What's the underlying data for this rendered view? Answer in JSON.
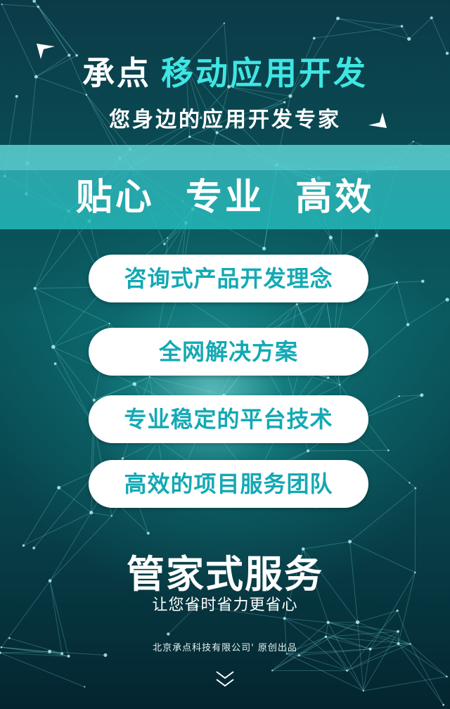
{
  "header": {
    "title_part1": "承点",
    "title_part2": "移动应用开发",
    "subtitle": "您身边的应用开发专家"
  },
  "banner": {
    "text": "贴心  专业  高效"
  },
  "features": [
    "咨询式产品开发理念",
    "全网解决方案",
    "专业稳定的平台技术",
    "高效的项目服务团队"
  ],
  "service": {
    "title": "管家式服务",
    "subtitle": "让您省时省力更省心"
  },
  "footer": {
    "credit": "北京承点科技有限公司' 原创出品"
  },
  "colors": {
    "accent": "#3fe6e2",
    "pill_text": "#13a9b4",
    "background_dark": "#0a4d55"
  },
  "icons": {
    "top_left": "arrow-corner-icon",
    "top_right": "arrow-corner-icon",
    "bottom": "double-chevron-down-icon"
  }
}
